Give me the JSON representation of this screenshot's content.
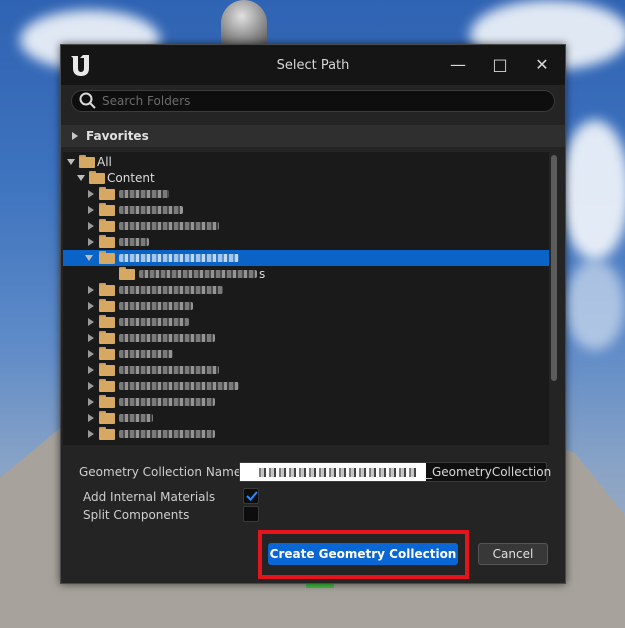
{
  "window": {
    "title": "Select Path"
  },
  "search": {
    "placeholder": "Search Folders"
  },
  "favorites": {
    "label": "Favorites"
  },
  "tree": {
    "root_label": "All",
    "content_label": "Content",
    "rows": [
      {
        "label": "",
        "selected": false,
        "expanded": false,
        "blur_w": 50
      },
      {
        "label": "",
        "selected": false,
        "expanded": false,
        "blur_w": 64
      },
      {
        "label": "",
        "selected": false,
        "expanded": false,
        "blur_w": 100
      },
      {
        "label": "",
        "selected": false,
        "expanded": false,
        "blur_w": 30
      },
      {
        "label": "",
        "selected": true,
        "expanded": true,
        "blur_w": 120
      },
      {
        "label": "s",
        "selected": false,
        "expanded": false,
        "blur_w": 118,
        "child": true
      },
      {
        "label": "",
        "selected": false,
        "expanded": false,
        "blur_w": 104
      },
      {
        "label": "",
        "selected": false,
        "expanded": false,
        "blur_w": 74
      },
      {
        "label": "",
        "selected": false,
        "expanded": false,
        "blur_w": 70
      },
      {
        "label": "",
        "selected": false,
        "expanded": false,
        "blur_w": 96
      },
      {
        "label": "",
        "selected": false,
        "expanded": false,
        "blur_w": 54
      },
      {
        "label": "",
        "selected": false,
        "expanded": false,
        "blur_w": 100
      },
      {
        "label": "",
        "selected": false,
        "expanded": false,
        "blur_w": 120
      },
      {
        "label": "",
        "selected": false,
        "expanded": false,
        "blur_w": 96
      },
      {
        "label": "",
        "selected": false,
        "expanded": false,
        "blur_w": 34
      },
      {
        "label": "",
        "selected": false,
        "expanded": false,
        "blur_w": 96
      }
    ]
  },
  "form": {
    "name_label": "Geometry Collection Name",
    "name_suffix": "_GeometryCollection",
    "add_internal_materials_label": "Add Internal Materials",
    "add_internal_materials_checked": true,
    "split_components_label": "Split Components",
    "split_components_checked": false
  },
  "buttons": {
    "create": "Create Geometry Collection",
    "cancel": "Cancel"
  },
  "colors": {
    "selection": "#0a64c8",
    "primary_button": "#0a66d2",
    "highlight_box": "#e3141c",
    "folder": "#d6a862"
  }
}
